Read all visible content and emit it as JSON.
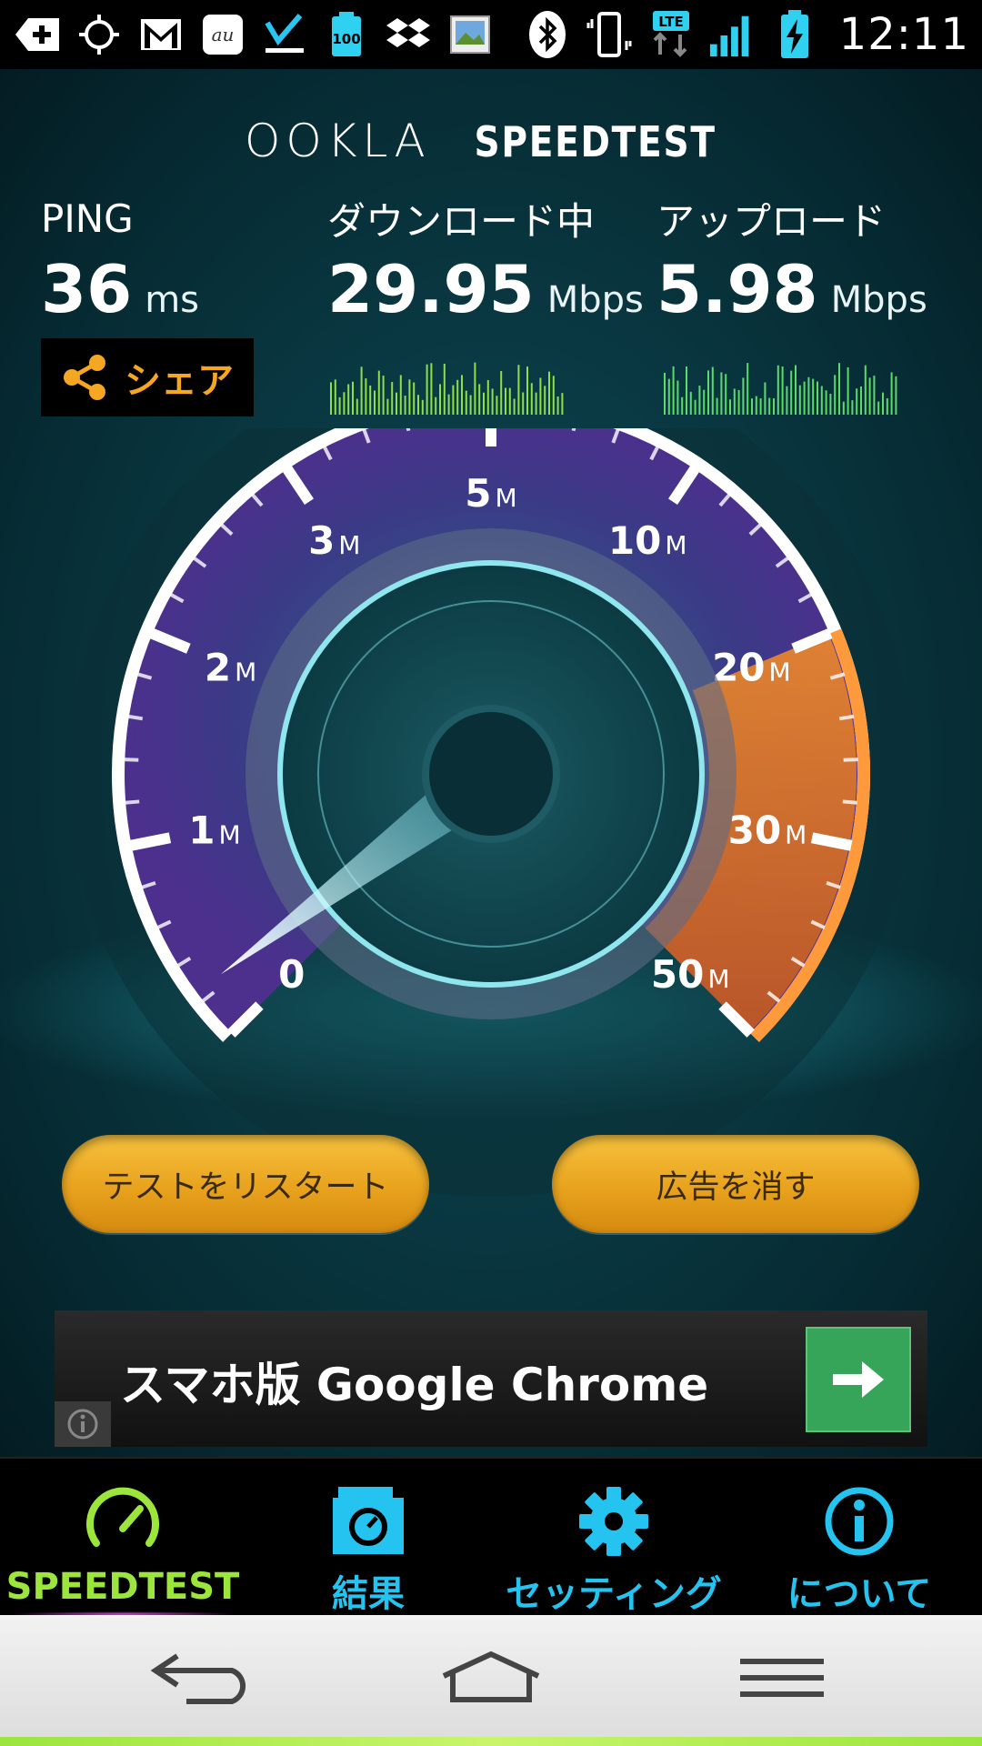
{
  "status_bar": {
    "time": "12:11",
    "battery_percent_label": "100",
    "network_label": "LTE",
    "carrier_icon_text": "au",
    "icons": [
      "plus-icon",
      "gps-icon",
      "gmail-icon",
      "au-icon",
      "check-icon",
      "battery-100-icon",
      "dropbox-icon",
      "gallery-icon",
      "bluetooth-icon",
      "vibrate-icon",
      "lte-icon",
      "signal-icon",
      "battery-charging-icon"
    ]
  },
  "app": {
    "brand_ookla": "OOKLA",
    "brand_speedtest": "SPEEDTEST",
    "ping": {
      "label": "PING",
      "value": "36",
      "unit": "ms"
    },
    "download": {
      "label": "ダウンロード中",
      "value": "29.95",
      "unit": "Mbps"
    },
    "upload": {
      "label": "アップロード",
      "value": "5.98",
      "unit": "Mbps"
    },
    "share_label": "シェア",
    "gauge": {
      "ticks": [
        {
          "label": "0",
          "unit": ""
        },
        {
          "label": "1",
          "unit": "M"
        },
        {
          "label": "2",
          "unit": "M"
        },
        {
          "label": "3",
          "unit": "M"
        },
        {
          "label": "5",
          "unit": "M"
        },
        {
          "label": "10",
          "unit": "M"
        },
        {
          "label": "20",
          "unit": "M"
        },
        {
          "label": "30",
          "unit": "M"
        },
        {
          "label": "50",
          "unit": "M"
        }
      ],
      "current_mbps": 29.95
    },
    "restart_label": "テストをリスタート",
    "remove_ads_label": "広告を消す",
    "ad_text": "スマホ版 Google Chrome"
  },
  "tabs": [
    {
      "label": "SPEEDTEST",
      "icon": "speedometer-icon",
      "active": true
    },
    {
      "label": "結果",
      "icon": "results-folder-icon",
      "active": false
    },
    {
      "label": "セッティング",
      "icon": "gear-icon",
      "active": false
    },
    {
      "label": "について",
      "icon": "info-icon",
      "active": false
    }
  ],
  "colors": {
    "active_tab": "#9be53c",
    "inactive_tab": "#25c3ef",
    "accent": "#f5a623"
  }
}
